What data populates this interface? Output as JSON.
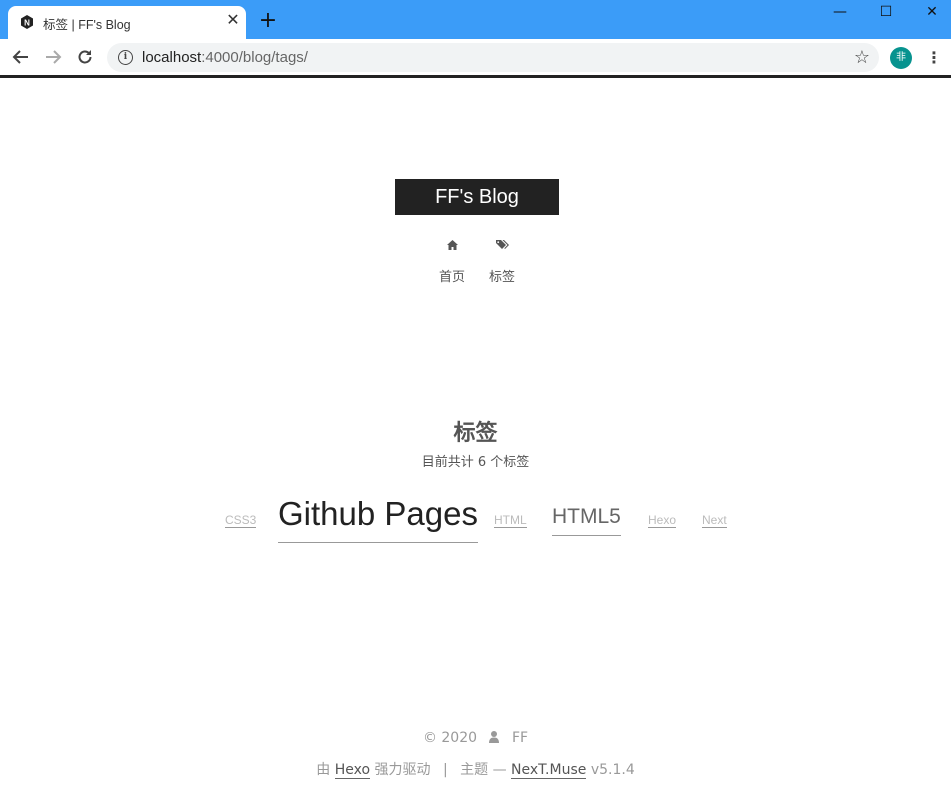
{
  "browser": {
    "tab_title": "标签 | FF's Blog",
    "tab_close": "✕",
    "new_tab": "+",
    "url_host": "localhost",
    "url_rest": ":4000/blog/tags/",
    "avatar_text": "非",
    "window_controls": {
      "minimize": "—",
      "maximize": "☐",
      "close": "✕"
    }
  },
  "site": {
    "brand": "FF's Blog",
    "menu": [
      {
        "label": "首页",
        "icon": "home-icon"
      },
      {
        "label": "标签",
        "icon": "tags-icon"
      }
    ]
  },
  "main": {
    "title": "标签",
    "count_text": "目前共计 6 个标签",
    "tags": [
      {
        "label": "CSS3"
      },
      {
        "label": "Github Pages"
      },
      {
        "label": "HTML"
      },
      {
        "label": "HTML5"
      },
      {
        "label": "Hexo"
      },
      {
        "label": "Next"
      }
    ]
  },
  "footer": {
    "copyright": "© 2020",
    "author": "FF",
    "powered_prefix": "由",
    "powered_link": "Hexo",
    "powered_suffix": "强力驱动",
    "separator": "|",
    "theme_prefix": "主题 —",
    "theme_link": "NexT.Muse",
    "theme_version": "v5.1.4"
  }
}
